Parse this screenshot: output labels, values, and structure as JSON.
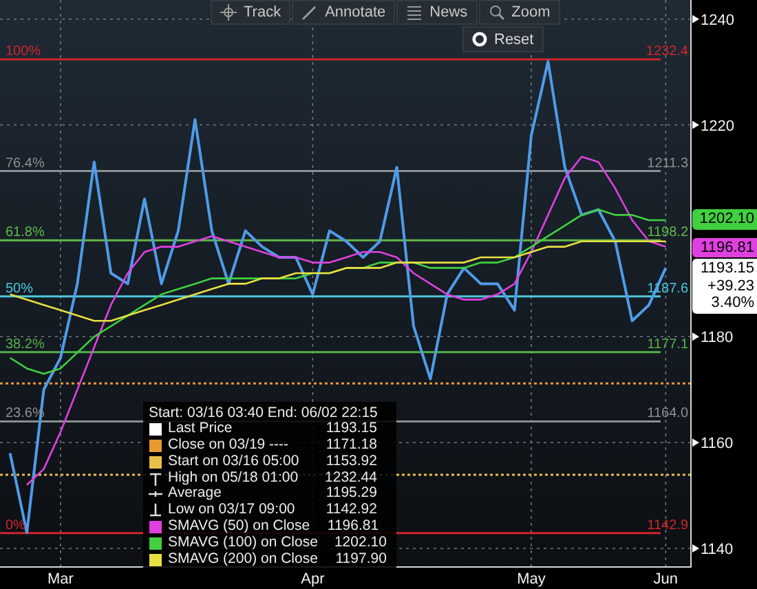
{
  "toolbar": {
    "items": [
      {
        "kind": "track",
        "label": "Track"
      },
      {
        "kind": "annotate",
        "label": "Annotate"
      },
      {
        "kind": "news",
        "label": "News"
      },
      {
        "kind": "zoom",
        "label": "Zoom"
      }
    ],
    "reset": {
      "label": "Reset"
    }
  },
  "chart": {
    "chart_data": {
      "type": "line",
      "categories": [
        null,
        null,
        null,
        "Mar",
        null,
        null,
        null,
        null,
        null,
        null,
        null,
        null,
        null,
        null,
        null,
        null,
        null,
        null,
        "Apr",
        null,
        null,
        null,
        null,
        null,
        null,
        null,
        null,
        null,
        null,
        null,
        null,
        "May",
        null,
        null,
        null,
        null,
        null,
        null,
        null,
        "Jun"
      ],
      "series": [
        {
          "name": "Last Price",
          "color": "#4f9be8",
          "values": [
            1158,
            1143,
            1170,
            1176,
            1190,
            1213,
            1192,
            1190,
            1206,
            1190,
            1200,
            1221,
            1200,
            1190,
            1200,
            1197,
            1195,
            1195,
            1188,
            1200,
            1198,
            1195,
            1198,
            1212,
            1182,
            1172,
            1188,
            1193,
            1190,
            1190,
            1185,
            1218,
            1232,
            1212,
            1203,
            1204,
            1198,
            1183,
            1186,
            1193
          ]
        },
        {
          "name": "SMAVG (50) on Close",
          "color": "#e040e0",
          "values": [
            null,
            1152,
            1155,
            1162,
            1170,
            1178,
            1186,
            1192,
            1196,
            1197,
            1197,
            1198,
            1199,
            1198,
            1197,
            1196,
            1195,
            1195,
            1194,
            1194,
            1195,
            1196,
            1196,
            1195,
            1192,
            1190,
            1188,
            1187,
            1187,
            1188,
            1190,
            1196,
            1203,
            1210,
            1214,
            1213,
            1208,
            1202,
            1198,
            1197
          ]
        },
        {
          "name": "SMAVG (100) on Close",
          "color": "#40d040",
          "values": [
            1176,
            1174,
            1173,
            1174,
            1177,
            1180,
            1182,
            1184,
            1186,
            1188,
            1189,
            1190,
            1191,
            1191,
            1191,
            1191,
            1191,
            1191,
            1192,
            1192,
            1193,
            1193,
            1194,
            1194,
            1194,
            1193,
            1193,
            1193,
            1194,
            1194,
            1195,
            1197,
            1199,
            1201,
            1203,
            1204,
            1203,
            1203,
            1202,
            1202
          ]
        },
        {
          "name": "SMAVG (200) on Close",
          "color": "#e8e040",
          "values": [
            1188,
            1187,
            1186,
            1185,
            1184,
            1183,
            1183,
            1184,
            1185,
            1186,
            1187,
            1188,
            1189,
            1190,
            1190,
            1191,
            1191,
            1192,
            1192,
            1192,
            1193,
            1193,
            1193,
            1194,
            1194,
            1194,
            1194,
            1194,
            1195,
            1195,
            1195,
            1196,
            1197,
            1197,
            1198,
            1198,
            1198,
            1198,
            1198,
            1198
          ]
        }
      ],
      "ylim": [
        1136.5,
        1243.6
      ],
      "grid": true,
      "yticks": [
        1140,
        1160,
        1180,
        1220,
        1240
      ],
      "ref_lines": [
        {
          "axis": "y",
          "value": 1232.4,
          "label": "1232.4",
          "color": "#d0262c"
        },
        {
          "axis": "y",
          "value": 1211.3,
          "label": "1211.3",
          "color": "#8a8f94"
        },
        {
          "axis": "y",
          "value": 1198.2,
          "label": "1198.2",
          "color": "#62b847"
        },
        {
          "axis": "y",
          "value": 1187.6,
          "label": "1187.6",
          "color": "#4cc8dc"
        },
        {
          "axis": "y",
          "value": 1177.1,
          "label": "1177.1",
          "color": "#55b04a"
        },
        {
          "axis": "y",
          "value": 1164.0,
          "label": "1164.0",
          "color": "#8a8f94"
        },
        {
          "axis": "y",
          "value": 1142.9,
          "label": "1142.9",
          "color": "#d0262c"
        },
        {
          "axis": "y",
          "value": 1171.18,
          "color": "#e89a30"
        },
        {
          "axis": "y",
          "value": 1153.92,
          "color": "#e8c048"
        }
      ]
    },
    "level_percents": [
      {
        "text": "100%"
      },
      {
        "text": "76.4%"
      },
      {
        "text": "61.8%"
      },
      {
        "text": "50%"
      },
      {
        "text": "38.2%"
      },
      {
        "text": "23.6%"
      },
      {
        "text": "0%"
      }
    ],
    "price_tags": [
      {
        "kind": "short",
        "text": "1202.10",
        "color": "#40d040"
      },
      {
        "kind": "short",
        "text": "1196.81",
        "color": "#e040e0"
      },
      {
        "kind": "last",
        "text": "1193.15",
        "change": "+39.23",
        "percent": "3.40%",
        "color": "#ffffff"
      }
    ]
  },
  "legend": {
    "header": "Start: 03/16 03:40 End: 06/02 22:15",
    "items": [
      {
        "kind": "series",
        "color": "#ffffff",
        "value": "1193.15"
      },
      {
        "kind": "swatch",
        "color": "#e89a30",
        "label": "Close on 03/19 ----",
        "value": "1171.18"
      },
      {
        "kind": "swatch",
        "color": "#e8c048",
        "label": "Start on 03/16 05:00",
        "value": "1153.92"
      },
      {
        "kind": "high",
        "label": "High on 05/18 01:00",
        "value": "1232.44"
      },
      {
        "kind": "average",
        "label": "Average",
        "value": "1195.29"
      },
      {
        "kind": "low",
        "label": "Low on 03/17 09:00",
        "value": "1142.92"
      },
      {
        "kind": "series",
        "color": "#e040e0",
        "value": "1196.81"
      },
      {
        "kind": "series",
        "color": "#40d040",
        "value": "1202.10"
      },
      {
        "kind": "series",
        "color": "#e8e040",
        "value": "1197.90"
      }
    ]
  }
}
